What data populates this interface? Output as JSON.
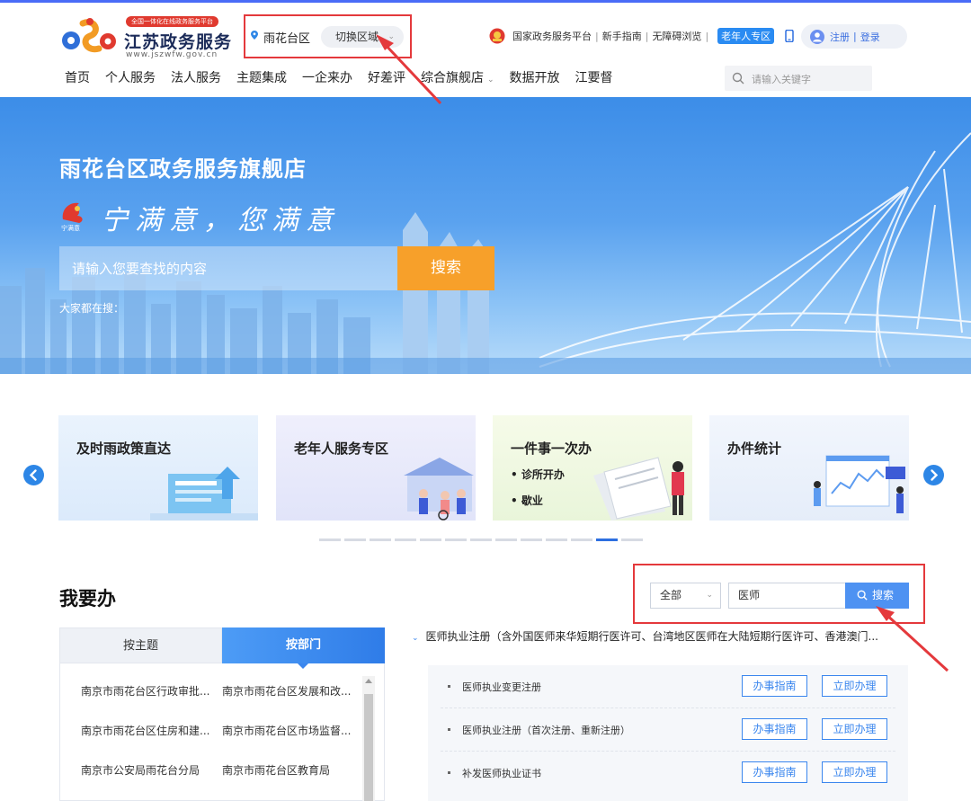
{
  "logo": {
    "banner": "全国一体化在线政务服务平台",
    "title": "江苏政务服务",
    "url": "www.jszwfw.gov.cn"
  },
  "region": {
    "current": "雨花台区",
    "switch_label": "切换区域"
  },
  "top_links": {
    "national_platform": "国家政务服务平台",
    "guide": "新手指南",
    "accessible": "无障碍浏览",
    "elder_zone": "老年人专区",
    "register": "注册",
    "login": "登录"
  },
  "nav": {
    "items": [
      "首页",
      "个人服务",
      "法人服务",
      "主题集成",
      "一企来办",
      "好差评",
      "综合旗舰店",
      "数据开放",
      "江要督"
    ],
    "search_placeholder": "请输入关键字"
  },
  "hero": {
    "title": "雨花台区政务服务旗舰店",
    "slogan": "宁满意，您满意",
    "slogan_logo_caption": "宁满意",
    "search_placeholder": "请输入您要查找的内容",
    "search_button": "搜索",
    "hot_label": "大家都在搜："
  },
  "carousel": {
    "cards": [
      {
        "title": "及时雨政策直达",
        "subs": []
      },
      {
        "title": "老年人服务专区",
        "subs": []
      },
      {
        "title": "一件事一次办",
        "subs": [
          "• 诊所开办",
          "• 歇业"
        ]
      },
      {
        "title": "办件统计",
        "subs": []
      }
    ],
    "dot_count": 13,
    "active_dot": 11
  },
  "woyaoban": {
    "title": "我要办",
    "scope_value": "全部",
    "keyword_value": "医师",
    "search_button": "搜索",
    "tabs": [
      "按主题",
      "按部门"
    ],
    "active_tab": "按部门",
    "departments": [
      [
        "南京市雨花台区行政审批...",
        "南京市雨花台区发展和改..."
      ],
      [
        "南京市雨花台区住房和建...",
        "南京市雨花台区市场监督..."
      ],
      [
        "南京市公安局雨花台分局",
        "南京市雨花台区教育局"
      ]
    ],
    "service_group_title": "医师执业注册（含外国医师来华短期行医许可、台湾地区医师在大陆短期行医许可、香港澳门...",
    "services": [
      {
        "name": "医师执业变更注册",
        "guide": "办事指南",
        "apply": "立即办理"
      },
      {
        "name": "医师执业注册（首次注册、重新注册）",
        "guide": "办事指南",
        "apply": "立即办理"
      },
      {
        "name": "补发医师执业证书",
        "guide": "办事指南",
        "apply": "立即办理"
      }
    ]
  },
  "colors": {
    "accent_blue": "#2d86e6",
    "orange": "#f7a02a",
    "highlight_red": "#e4393c"
  }
}
